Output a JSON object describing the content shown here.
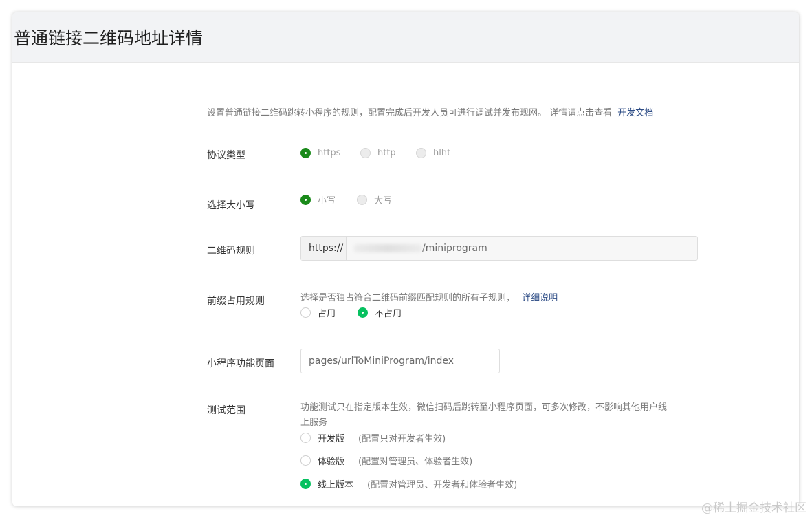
{
  "header": {
    "title": "普通链接二维码地址详情"
  },
  "intro": {
    "text": "设置普通链接二维码跳转小程序的规则，配置完成后开发人员可进行调试并发布现网。 详情请点击查看",
    "link": "开发文档"
  },
  "protocol": {
    "label": "协议类型",
    "options": [
      "https",
      "http",
      "hlht"
    ],
    "selected": "https"
  },
  "case": {
    "label": "选择大小写",
    "options": [
      "小写",
      "大写"
    ],
    "selected": "小写"
  },
  "qr_rule": {
    "label": "二维码规则",
    "prefix": "https://",
    "value": "/miniprogram"
  },
  "prefix_rule": {
    "label": "前缀占用规则",
    "desc": "选择是否独占符合二维码前缀匹配规则的所有子规则，",
    "link": "详细说明",
    "options": [
      "占用",
      "不占用"
    ],
    "selected": "不占用"
  },
  "page_path": {
    "label": "小程序功能页面",
    "value": "pages/urlToMiniProgram/index"
  },
  "test_scope": {
    "label": "测试范围",
    "desc_line1": "功能测试只在指定版本生效，微信扫码后跳转至小程序页面，可多次修改，不影响其他用户线",
    "desc_line2": "上服务",
    "options": [
      {
        "label": "开发版",
        "note": "(配置只对开发者生效)"
      },
      {
        "label": "体验版",
        "note": "(配置对管理员、体验者生效)"
      },
      {
        "label": "线上版本",
        "note": "(配置对管理员、开发者和体验者生效)"
      }
    ],
    "selected": "线上版本"
  },
  "watermark": "@稀土掘金技术社区",
  "colors": {
    "accent_green": "#07c160",
    "link_blue": "#2e4d86",
    "header_bg": "#f2f3f5"
  }
}
